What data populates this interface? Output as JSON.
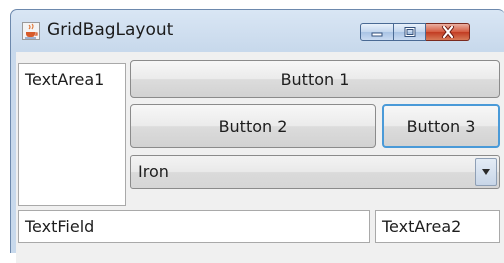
{
  "window": {
    "title": "GridBagLayout",
    "app_icon": "java-cup-icon",
    "controls": {
      "minimize": "minimize-icon",
      "maximize": "maximize-icon",
      "close": "close-icon"
    }
  },
  "content": {
    "textarea1": "TextArea1",
    "button1": "Button 1",
    "button2": "Button 2",
    "button3": "Button 3",
    "combo": {
      "selected": "Iron",
      "arrow_icon": "chevron-down-icon"
    },
    "textfield": "TextField",
    "textarea2": "TextArea2"
  },
  "colors": {
    "focus_border": "#4a9ad8",
    "close_button": "#c23b22"
  }
}
